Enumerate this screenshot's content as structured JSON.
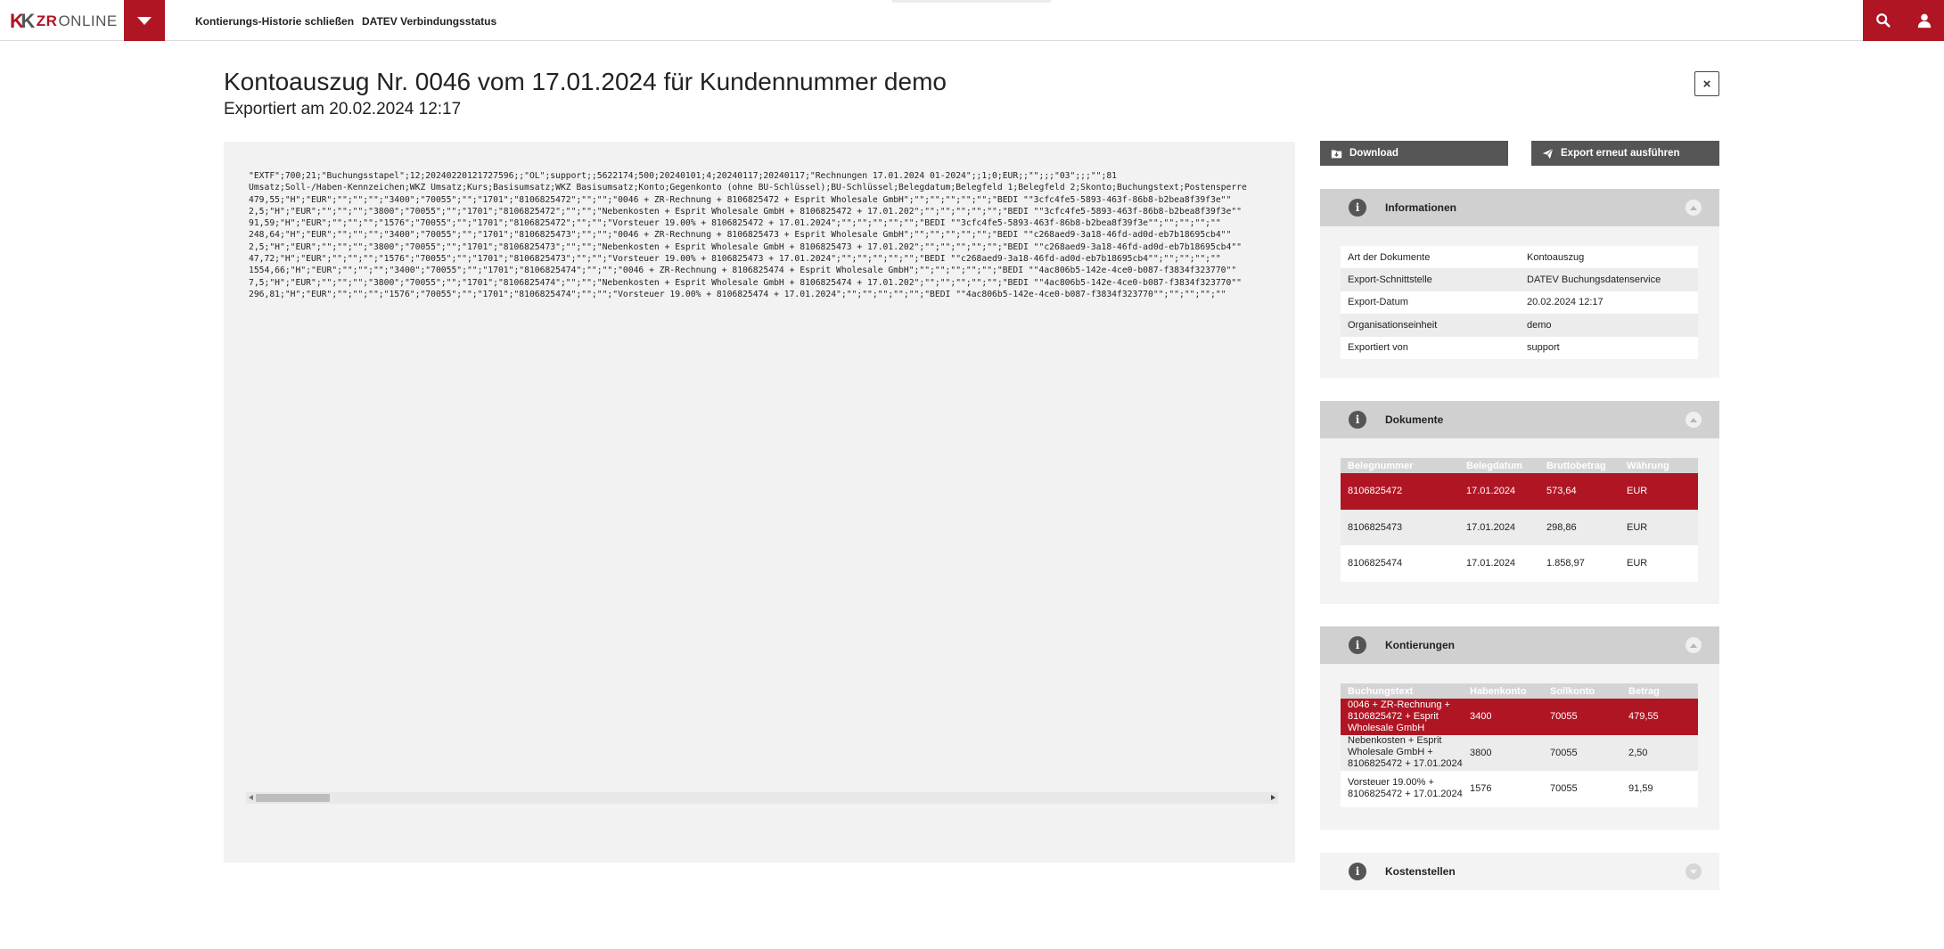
{
  "topbar": {
    "logo_kk": "K",
    "logo_kk2": "K",
    "logo_zr": "ZR",
    "logo_online": "ONLINE",
    "nav": [
      {
        "label": "Kontierungs-Historie schließen"
      },
      {
        "label": "DATEV Verbindungsstatus"
      }
    ],
    "accent_color": "#b01524"
  },
  "header": {
    "title": "Kontoauszug Nr. 0046 vom 17.01.2024 für Kundennummer demo",
    "subtitle": "Exportiert am 20.02.2024 12:17",
    "close_label": "×"
  },
  "export": {
    "lines": [
      "\"EXTF\";700;21;\"Buchungsstapel\";12;20240220121727596;;\"OL\";support;;5622174;500;20240101;4;20240117;20240117;\"Rechnungen 17.01.2024 01-2024\";;1;0;EUR;;\"\";;;\"03\";;;\"\";81",
      "Umsatz;Soll-/Haben-Kennzeichen;WKZ Umsatz;Kurs;Basisumsatz;WKZ Basisumsatz;Konto;Gegenkonto (ohne BU-Schlüssel);BU-Schlüssel;Belegdatum;Belegfeld 1;Belegfeld 2;Skonto;Buchungstext;Postensperre",
      "479,55;\"H\";\"EUR\";\"\";\"\";\"\";\"3400\";\"70055\";\"\";\"1701\";\"8106825472\";\"\";\"\";\"0046 + ZR-Rechnung + 8106825472 + Esprit Wholesale GmbH\";\"\";\"\";\"\";\"\";\"\";\"BEDI \"\"3cfc4fe5-5893-463f-86b8-b2bea8f39f3e\"\"",
      "2,5;\"H\";\"EUR\";\"\";\"\";\"\";\"3800\";\"70055\";\"\";\"1701\";\"8106825472\";\"\";\"\";\"Nebenkosten + Esprit Wholesale GmbH + 8106825472 + 17.01.202\";\"\";\"\";\"\";\"\";\"\";\"BEDI \"\"3cfc4fe5-5893-463f-86b8-b2bea8f39f3e\"\"",
      "91,59;\"H\";\"EUR\";\"\";\"\";\"\";\"1576\";\"70055\";\"\";\"1701\";\"8106825472\";\"\";\"\";\"Vorsteuer 19.00% + 8106825472 + 17.01.2024\";\"\";\"\";\"\";\"\";\"\";\"BEDI \"\"3cfc4fe5-5893-463f-86b8-b2bea8f39f3e\"\";\"\";\"\";\"\";\"\"",
      "248,64;\"H\";\"EUR\";\"\";\"\";\"\";\"3400\";\"70055\";\"\";\"1701\";\"8106825473\";\"\";\"\";\"0046 + ZR-Rechnung + 8106825473 + Esprit Wholesale GmbH\";\"\";\"\";\"\";\"\";\"\";\"BEDI \"\"c268aed9-3a18-46fd-ad0d-eb7b18695cb4\"\"",
      "2,5;\"H\";\"EUR\";\"\";\"\";\"\";\"3800\";\"70055\";\"\";\"1701\";\"8106825473\";\"\";\"\";\"Nebenkosten + Esprit Wholesale GmbH + 8106825473 + 17.01.202\";\"\";\"\";\"\";\"\";\"\";\"BEDI \"\"c268aed9-3a18-46fd-ad0d-eb7b18695cb4\"\"",
      "47,72;\"H\";\"EUR\";\"\";\"\";\"\";\"1576\";\"70055\";\"\";\"1701\";\"8106825473\";\"\";\"\";\"Vorsteuer 19.00% + 8106825473 + 17.01.2024\";\"\";\"\";\"\";\"\";\"\";\"BEDI \"\"c268aed9-3a18-46fd-ad0d-eb7b18695cb4\"\";\"\";\"\";\"\";\"\"",
      "1554,66;\"H\";\"EUR\";\"\";\"\";\"\";\"3400\";\"70055\";\"\";\"1701\";\"8106825474\";\"\";\"\";\"0046 + ZR-Rechnung + 8106825474 + Esprit Wholesale GmbH\";\"\";\"\";\"\";\"\";\"\";\"BEDI \"\"4ac806b5-142e-4ce0-b087-f3834f323770\"\"",
      "7,5;\"H\";\"EUR\";\"\";\"\";\"\";\"3800\";\"70055\";\"\";\"1701\";\"8106825474\";\"\";\"\";\"Nebenkosten + Esprit Wholesale GmbH + 8106825474 + 17.01.202\";\"\";\"\";\"\";\"\";\"\";\"BEDI \"\"4ac806b5-142e-4ce0-b087-f3834f323770\"\"",
      "296,81;\"H\";\"EUR\";\"\";\"\";\"\";\"1576\";\"70055\";\"\";\"1701\";\"8106825474\";\"\";\"\";\"Vorsteuer 19.00% + 8106825474 + 17.01.2024\";\"\";\"\";\"\";\"\";\"\";\"BEDI \"\"4ac806b5-142e-4ce0-b087-f3834f323770\"\";\"\";\"\";\"\";\"\""
    ]
  },
  "actions": {
    "download_label": "Download",
    "export_again_label": "Export erneut ausführen"
  },
  "informationen": {
    "title": "Informationen",
    "rows": [
      {
        "key": "Art der Dokumente",
        "value": "Kontoauszug"
      },
      {
        "key": "Export-Schnittstelle",
        "value": "DATEV Buchungsdatenservice"
      },
      {
        "key": "Export-Datum",
        "value": "20.02.2024 12:17"
      },
      {
        "key": "Organisationseinheit",
        "value": "demo"
      },
      {
        "key": "Exportiert von",
        "value": "support"
      }
    ]
  },
  "dokumente": {
    "title": "Dokumente",
    "columns": [
      "Belegnummer",
      "Belegdatum",
      "Bruttobetrag",
      "Währung"
    ],
    "rows": [
      {
        "belegnummer": "8106825472",
        "belegdatum": "17.01.2024",
        "brutto": "573,64",
        "waehrung": "EUR"
      },
      {
        "belegnummer": "8106825473",
        "belegdatum": "17.01.2024",
        "brutto": "298,86",
        "waehrung": "EUR"
      },
      {
        "belegnummer": "8106825474",
        "belegdatum": "17.01.2024",
        "brutto": "1.858,97",
        "waehrung": "EUR"
      }
    ]
  },
  "kontierungen": {
    "title": "Kontierungen",
    "columns": [
      "Buchungstext",
      "Habenkonto",
      "Sollkonto",
      "Betrag"
    ],
    "rows": [
      {
        "text": "0046 + ZR-Rechnung + 8106825472 + Esprit Wholesale GmbH",
        "haben": "3400",
        "soll": "70055",
        "betrag": "479,55"
      },
      {
        "text": "Nebenkosten + Esprit Wholesale GmbH + 8106825472 + 17.01.2024",
        "haben": "3800",
        "soll": "70055",
        "betrag": "2,50"
      },
      {
        "text": "Vorsteuer 19.00% + 8106825472 + 17.01.2024",
        "haben": "1576",
        "soll": "70055",
        "betrag": "91,59"
      }
    ]
  },
  "kostenstellen": {
    "title": "Kostenstellen"
  }
}
